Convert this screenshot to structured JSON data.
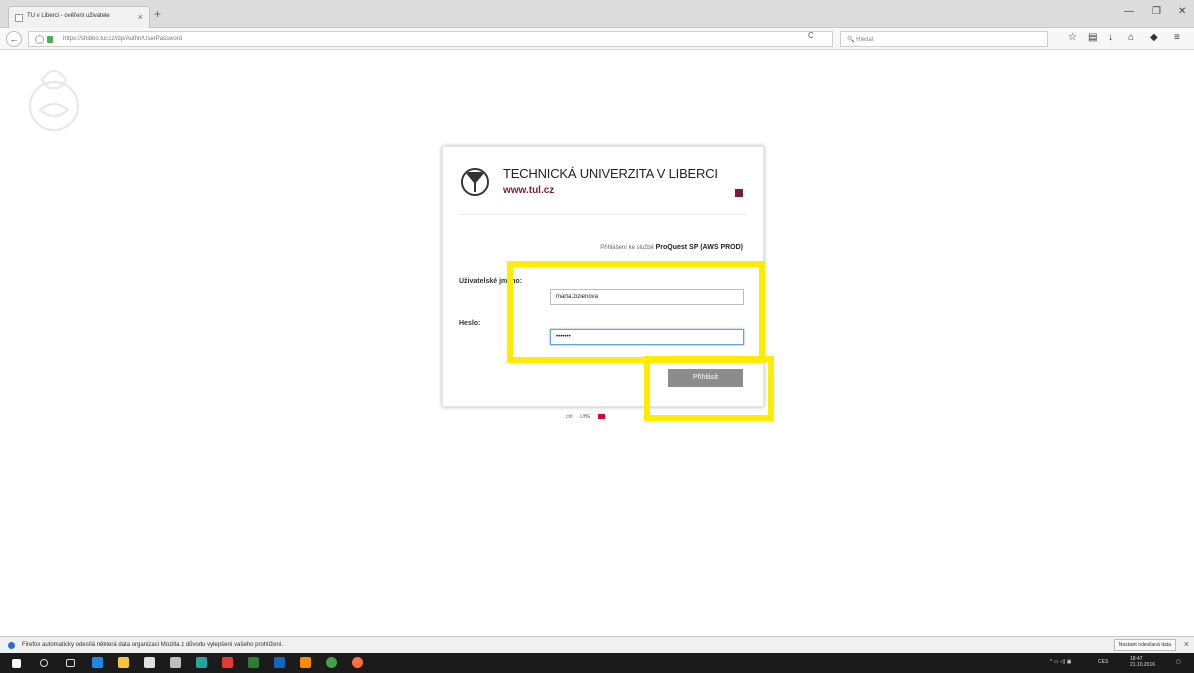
{
  "browser": {
    "tab_title": "TU v Liberci - ověření uživatele",
    "url": "https://shibbo.tul.cz/idp/Authn/UserPassword",
    "search_placeholder": "Hledat"
  },
  "login": {
    "university_name": "TECHNICKÁ UNIVERZITA V LIBERCI",
    "university_url": "www.tul.cz",
    "service_prefix": "Přihlášení ke službě",
    "service_name": "ProQuest SP (AWS PROD)",
    "username_label": "Uživatelské jméno:",
    "username_value": "marta.zizienova",
    "password_label": "Heslo:",
    "password_value": "•••••••",
    "submit_label": "Přihlásit"
  },
  "languages": [
    "ctrl",
    "UHE"
  ],
  "notification": {
    "text": "Firefox automaticky odesílá některá data organizaci Mozilla z důvodu vylepšení vašeho prohlížení.",
    "button": "Nastavit odesílaná data"
  },
  "taskbar": {
    "tray_lang": "CES",
    "time": "18:47",
    "date": "21.10.2016"
  },
  "colors": {
    "highlight": "#ffec00",
    "brand": "#7b1d3a"
  }
}
